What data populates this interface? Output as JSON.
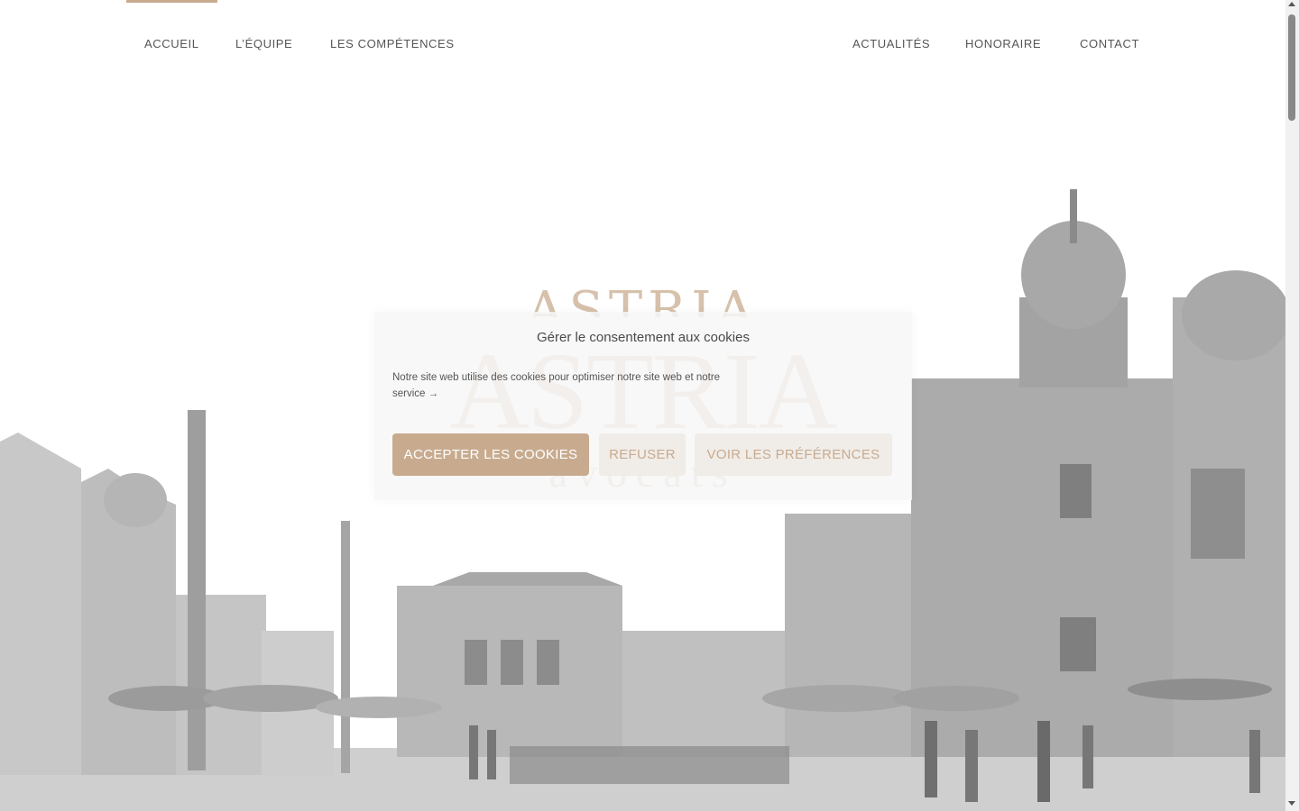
{
  "nav": {
    "items": [
      {
        "label": "ACCUEIL"
      },
      {
        "label": "L’ÉQUIPE"
      },
      {
        "label": "LES COMPÉTENCES"
      },
      {
        "label": "ACTUALITÉS"
      },
      {
        "label": "HONORAIRE"
      },
      {
        "label": "CONTACT"
      }
    ],
    "accent_color": "#c9ab8f"
  },
  "hero": {
    "logo_top": "ASTRIA",
    "logo_main": "ASTRIA",
    "logo_sub": "avocats"
  },
  "cookie_dialog": {
    "title": "Gérer le consentement aux cookies",
    "text": "Notre site web utilise des cookies pour optimiser notre site web et notre",
    "link": "service →",
    "accept_label": "ACCEPTER LES COOKIES",
    "refuse_label": "REFUSER",
    "prefs_label": "VOIR LES PRÉFÉRENCES",
    "accent_color": "#c8ab8f"
  }
}
